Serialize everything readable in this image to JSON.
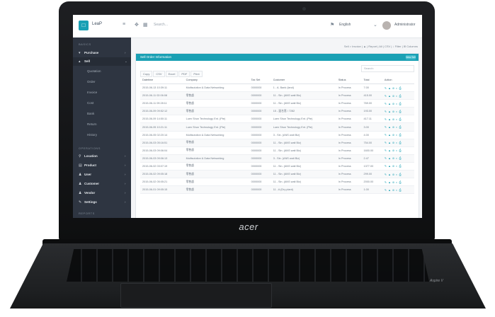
{
  "laptop": {
    "brand": "acer",
    "model": "Aspire V"
  },
  "topbar": {
    "logo_mark": "□",
    "app_name": "LeaP",
    "search_placeholder": "Search...",
    "right_items": [
      "English",
      "Administrator"
    ]
  },
  "sidebar": {
    "section1": "BASICS",
    "items_top": [
      {
        "icon": "purchase-icon",
        "label": "Purchase"
      },
      {
        "icon": "sell-icon",
        "label": "Sell"
      }
    ],
    "subitems": [
      "Quotation",
      "Order",
      "Invoice",
      "Cost",
      "Bank",
      "Return",
      "History"
    ],
    "section2": "OPERATIONS",
    "items_bottom": [
      {
        "icon": "location-icon",
        "label": "Location"
      },
      {
        "icon": "product-icon",
        "label": "Product"
      },
      {
        "icon": "user-icon",
        "label": "User"
      },
      {
        "icon": "customer-icon",
        "label": "Customer"
      },
      {
        "icon": "vendor-icon",
        "label": "Vendor"
      },
      {
        "icon": "settings-icon",
        "label": "Settings"
      }
    ],
    "section3": "REPORTS"
  },
  "main": {
    "breadcrumb": "Sell > Invoice | ▲ | Report | All | CSV | ↓ Filter | ⊞ Columns",
    "panel_title": "Sell Order Information",
    "panel_button": "New Sell",
    "tools": [
      "Copy",
      "CSV",
      "Excel",
      "PDF",
      "Print"
    ],
    "search_placeholder": "Search:",
    "columns": [
      "Datetime",
      "Company",
      "Tax Set",
      "Customer",
      "Status",
      "Total",
      "Action"
    ],
    "rows": [
      [
        "2015-06-13 10:39:11",
        "Multisolution & Data Networking",
        "0000000",
        "1 - A. Bank (land)",
        "In Process",
        "7.00",
        "✎ ▲ ⊘ ◐ ⎙"
      ],
      [
        "2015-06-11 02:06:08",
        "零售處",
        "0000000",
        "11 - Sin. (ANS wait Biz)",
        "In Process",
        "415.00",
        "✎ ▲ ⊘ ◐ ⎙"
      ],
      [
        "2015-06-11 09:28:11",
        "零售處",
        "0000000",
        "11 - Sin. (ANS wait Biz)",
        "In Process",
        "769.00",
        "✎ ▲ ⊘ ◐ ⎙"
      ],
      [
        "2015-06-09 09:52:12",
        "零售處",
        "0000000",
        "15 - 溫名恩 / 7282",
        "In Process",
        "193.00",
        "✎ ▲ ⊘ ◐ ⎙"
      ],
      [
        "2015-06-09 14:50:11",
        "Luen Shun Technology Ent. (Pte)",
        "0000000",
        "Luen Shun Technology Ent. (Pte)",
        "In Process",
        "417.11",
        "✎ ▲ ⊘ ◐ ⎙"
      ],
      [
        "2015-06-05 10:21:11",
        "Luen Shun Technology Ent. (Pte)",
        "0000000",
        "Luen Shun Technology Ent. (Pte)",
        "In Process",
        "3.00",
        "✎ ▲ ⊘ ◐ ⎙"
      ],
      [
        "2015-06-05 02:20:14",
        "Multisolution & Data Networking",
        "0000000",
        "3 - Sin. (ANS wait Biz)",
        "In Process",
        "4.00",
        "✎ ▲ ⊘ ◐ ⎙"
      ],
      [
        "2015-06-03 05:16:51",
        "零售處",
        "0000000",
        "11 - Sin. (ANS wait Biz)",
        "In Process",
        "754.00",
        "✎ ▲ ⊘ ◐ ⎙"
      ],
      [
        "2015-06-03 09:06:04",
        "零售處",
        "0000000",
        "11 - Sin. (ANS wait Biz)",
        "In Process",
        "1600.00",
        "✎ ▲ ⊘ ◐ ⎙"
      ],
      [
        "2015-06-03 09:06:13",
        "Multisolution & Data Networking",
        "0000000",
        "3 - Sin. (ANS wait Biz)",
        "In Process",
        "2.47",
        "✎ ▲ ⊘ ◐ ⎙"
      ],
      [
        "2015-06-02 03:07:19",
        "零售處",
        "0000000",
        "11 - Sin. (ANS wait Biz)",
        "In Process",
        "1377.00",
        "✎ ▲ ⊘ ◐ ⎙"
      ],
      [
        "2015-06-02 09:05:18",
        "零售處",
        "0000000",
        "11 - Sin. (ANS wait Biz)",
        "In Process",
        "299.00",
        "✎ ▲ ⊘ ◐ ⎙"
      ],
      [
        "2015-06-02 05:05:21",
        "零售處",
        "0000000",
        "11 - Sin. (ANS wait Biz)",
        "In Process",
        "2000.00",
        "✎ ▲ ⊘ ◐ ⎙"
      ],
      [
        "2015-06-01 09:05:15",
        "零售處",
        "0000000",
        "11 - A (Dry plant)",
        "In Process",
        "1.00",
        "✎ ▲ ⊘ ◐ ⎙"
      ]
    ]
  },
  "colors": {
    "accent": "#1aa0b4",
    "sidebar": "#2e3541"
  }
}
